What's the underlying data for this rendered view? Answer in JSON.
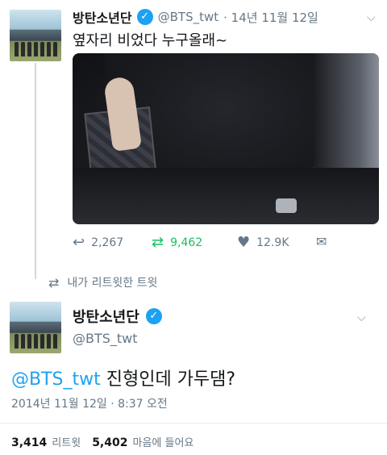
{
  "original_tweet": {
    "display_name": "방탄소년단",
    "handle": "@BTS_twt",
    "time": "· 14년 11월 12일",
    "text": "옆자리 비었다 누구올래~",
    "actions": {
      "reply_count": "2,267",
      "retweet_count": "9,462",
      "like_count": "12.9K"
    }
  },
  "retweet_context": "내가 리트윗한 트윗",
  "main_tweet": {
    "display_name": "방탄소년단",
    "handle": "@BTS_twt",
    "mention": "@BTS_twt",
    "text": " 진형인데 가두댐?",
    "timestamp": "2014년 11월 12일 · 8:37 오전",
    "stats": {
      "retweets_value": "3,414",
      "retweets_label": "리트윗",
      "likes_value": "5,402",
      "likes_label": "마음에 들어요"
    }
  },
  "colors": {
    "accent_blue": "#1da1f2",
    "retweet_green": "#17bf63",
    "secondary_text": "#657786"
  },
  "icons": [
    "verified-badge-icon",
    "chevron-down-icon",
    "reply-icon",
    "retweet-icon",
    "heart-icon",
    "dm-icon"
  ]
}
